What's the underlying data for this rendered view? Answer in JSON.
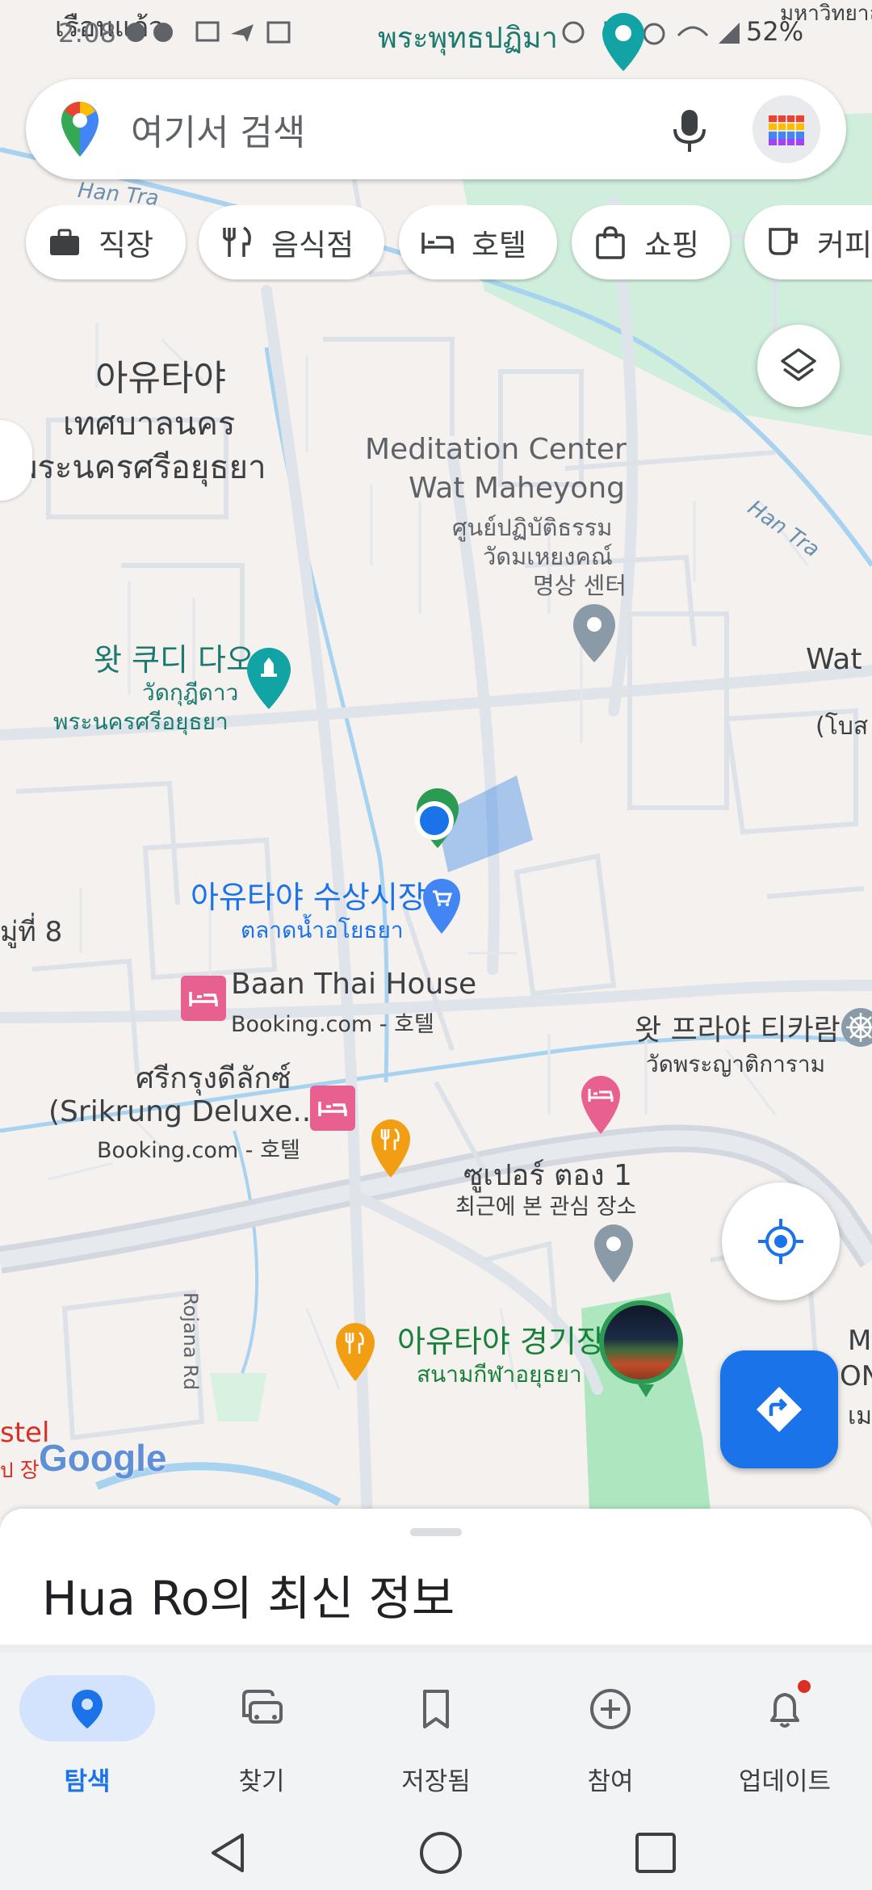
{
  "status_bar": {
    "time": "2:08",
    "battery": "52%",
    "ticker_text_left": "เรือนแก้ว",
    "ticker_text_center": "พระพุทธปฏิมา",
    "ticker_text_right": "มหาวิทยาลัย ราชมงคล"
  },
  "search": {
    "placeholder": "여기서 검색",
    "maps_logo_icon": "maps-pin-logo",
    "mic_icon": "mic-icon",
    "avatar_icon": "profile-avatar"
  },
  "chips": [
    {
      "label": "직장",
      "icon": "briefcase-icon"
    },
    {
      "label": "음식점",
      "icon": "restaurant-icon"
    },
    {
      "label": "호텔",
      "icon": "hotel-icon"
    },
    {
      "label": "쇼핑",
      "icon": "shopping-bag-icon"
    },
    {
      "label": "커피",
      "icon": "coffee-icon"
    }
  ],
  "map": {
    "district_label": [
      "아유타야",
      "เทศบาลนคร",
      "พระนครศรีอยุธยา"
    ],
    "meditation_center": [
      "Meditation Center",
      "Wat Maheyong",
      "ศูนย์ปฏิบัติธรรม",
      "วัดมเหยงคณ์",
      "명상 센터"
    ],
    "wat_kudi_dao": [
      "왓 쿠디 다오",
      "วัดกุฎีดาว",
      "พระนครศรีอยุธยา"
    ],
    "wat_partial": [
      "Wat",
      "(โบส"
    ],
    "floating_market": [
      "아유타야 수상시장",
      "ตลาดน้ำอโยธยา"
    ],
    "moo_label": "มู่ที่ 8",
    "baan_thai_house": [
      "Baan Thai House",
      "Booking.com - 호텔"
    ],
    "srikrung": [
      "ศรีกรุงดีลักซ์",
      "(Srikrung Deluxe...",
      "Booking.com - 호텔"
    ],
    "wat_phraya": [
      "왓 프라야 티카람",
      "วัดพระญาติการาม"
    ],
    "super_tong": [
      "ซูเปอร์ ตอง 1",
      "최근에 본 관심 장소"
    ],
    "stadium": [
      "아유타야 경기장",
      "สนามกีฬาอยุธยา"
    ],
    "road_han_tra_1": "Han Tra",
    "road_han_tra_2": "Han Tra",
    "road_rojana": "Rojana Rd",
    "edge_left_bottom": [
      "stel",
      "ป 장"
    ],
    "edge_right_bottom": [
      "M",
      "ON",
      "เม"
    ],
    "google_logo": "Google"
  },
  "sheet": {
    "title": "Hua Ro의 최신 정보"
  },
  "bottom_nav": [
    {
      "label": "탐색",
      "icon": "explore-pin-icon",
      "active": true
    },
    {
      "label": "찾기",
      "icon": "commute-car-icon",
      "active": false
    },
    {
      "label": "저장됨",
      "icon": "bookmark-icon",
      "active": false
    },
    {
      "label": "참여",
      "icon": "add-circle-icon",
      "active": false
    },
    {
      "label": "업데이트",
      "icon": "bell-icon",
      "active": false,
      "badge": true
    }
  ],
  "colors": {
    "accent_blue": "#1a73e8",
    "park_green": "#c7ead3",
    "water_blue": "#a7d3f0",
    "road_gray": "#dfe3ea",
    "highway_gray": "#d3d8e0",
    "hotel_pink": "#e8608f",
    "restaurant_orange": "#f29e12",
    "teal_poi": "#12a4a4"
  }
}
